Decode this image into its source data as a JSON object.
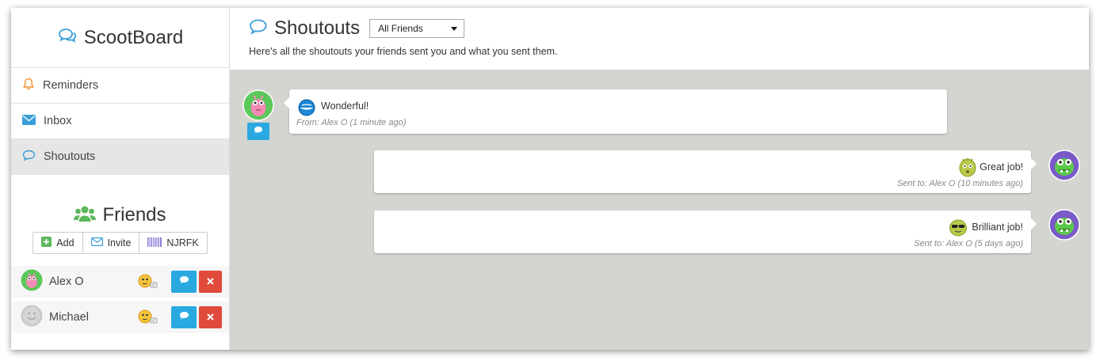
{
  "app": {
    "title": "ScootBoard"
  },
  "sidebar": {
    "items": [
      {
        "label": "Reminders",
        "icon": "bell-icon"
      },
      {
        "label": "Inbox",
        "icon": "envelope-icon"
      },
      {
        "label": "Shoutouts",
        "icon": "speech-bubble-icon",
        "active": true
      }
    ]
  },
  "friends": {
    "title": "Friends",
    "buttons": {
      "add": "Add",
      "invite": "Invite",
      "code": "NJRFK"
    },
    "list": [
      {
        "name": "Alex O",
        "avatar": "pink-monster-avatar"
      },
      {
        "name": "Michael",
        "avatar": "gray-smiley-avatar"
      }
    ]
  },
  "main": {
    "title": "Shoutouts",
    "filter": {
      "selected": "All Friends"
    },
    "subtitle": "Here's all the shoutouts your friends sent you and what you sent them."
  },
  "shoutouts": [
    {
      "direction": "received",
      "text": "Wonderful!",
      "meta": "From: Alex O (1 minute ago)",
      "emoji": "blue-ball-emoji"
    },
    {
      "direction": "sent",
      "text": "Great job!",
      "meta": "Sent to: Alex O (10 minutes ago)",
      "emoji": "green-blob-emoji"
    },
    {
      "direction": "sent",
      "text": "Brilliant job!",
      "meta": "Sent to: Alex O (5 days ago)",
      "emoji": "sunglasses-emoji"
    }
  ],
  "colors": {
    "accent": "#29a9e0",
    "danger": "#e04a3a",
    "feed_bg": "#d4d4d1",
    "friends_icon": "#5cb85c",
    "bell": "#f0922b"
  }
}
